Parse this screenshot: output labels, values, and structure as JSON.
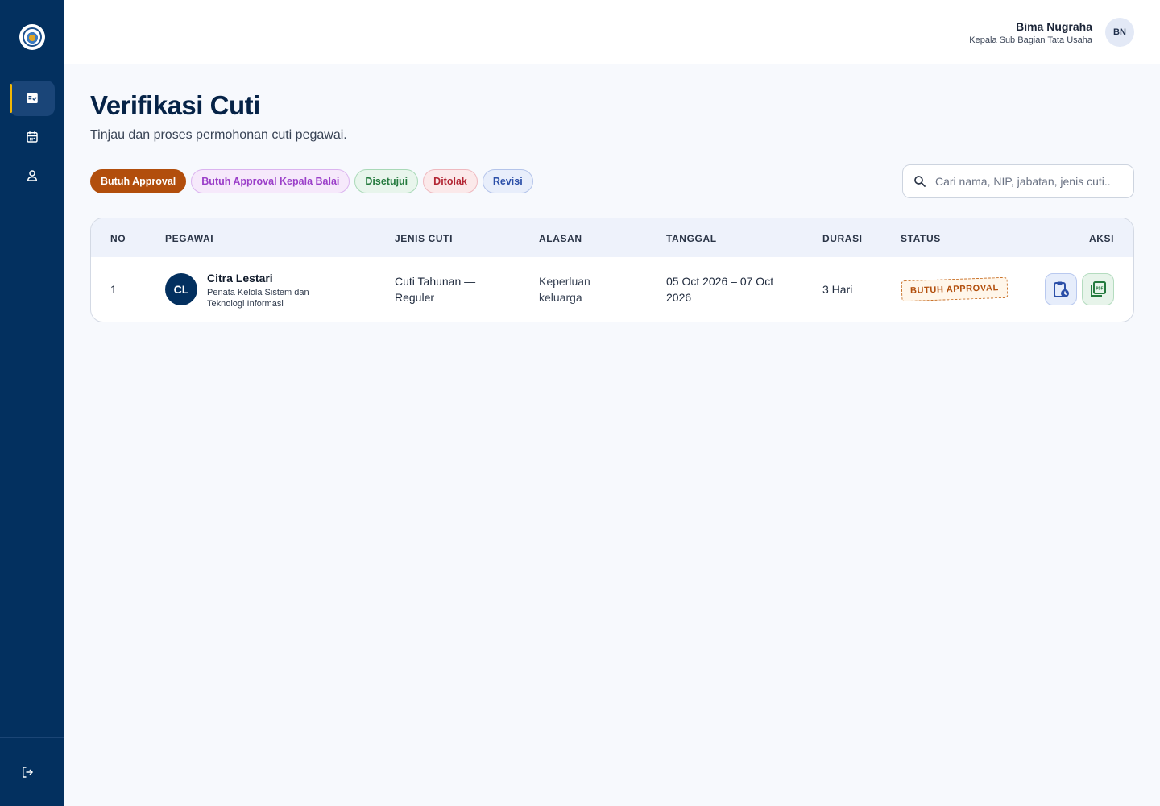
{
  "header": {
    "user_name": "Bima Nugraha",
    "user_role": "Kepala Sub Bagian Tata Usaha",
    "user_initials": "BN"
  },
  "sidebar": {
    "items": [
      {
        "icon": "checklist-icon",
        "active": true
      },
      {
        "icon": "calendar-icon",
        "active": false
      },
      {
        "icon": "user-icon",
        "active": false
      }
    ],
    "logout_icon": "logout-icon"
  },
  "page": {
    "title": "Verifikasi Cuti",
    "subtitle": "Tinjau dan proses permohonan cuti pegawai."
  },
  "filters": [
    {
      "label": "Butuh Approval",
      "color": "#b24e0c",
      "active": true
    },
    {
      "label": "Butuh Approval Kepala Balai",
      "color": "#9b3fc9",
      "active": false
    },
    {
      "label": "Disetujui",
      "color": "#247a3e",
      "active": false
    },
    {
      "label": "Ditolak",
      "color": "#b32634",
      "active": false
    },
    {
      "label": "Revisi",
      "color": "#2b4fa8",
      "active": false
    }
  ],
  "search": {
    "placeholder": "Cari nama, NIP, jabatan, jenis cuti..",
    "value": ""
  },
  "table": {
    "columns": [
      "NO",
      "PEGAWAI",
      "JENIS CUTI",
      "ALASAN",
      "TANGGAL",
      "DURASI",
      "STATUS",
      "AKSI"
    ],
    "rows": [
      {
        "no": "1",
        "initials": "CL",
        "name": "Citra Lestari",
        "position": "Penata Kelola Sistem dan Teknologi Informasi",
        "jenis_cuti": "Cuti Tahunan — Reguler",
        "alasan": "Keperluan keluarga",
        "tanggal": "05 Oct 2026 – 07 Oct 2026",
        "durasi": "3 Hari",
        "status": "BUTUH APPROVAL",
        "actions": [
          "clipboard-clock-icon",
          "pdf-icon"
        ]
      }
    ]
  },
  "colors": {
    "sidebar": "#03305f",
    "accent": "#f2b705",
    "status_pending": "#b24e0c"
  }
}
